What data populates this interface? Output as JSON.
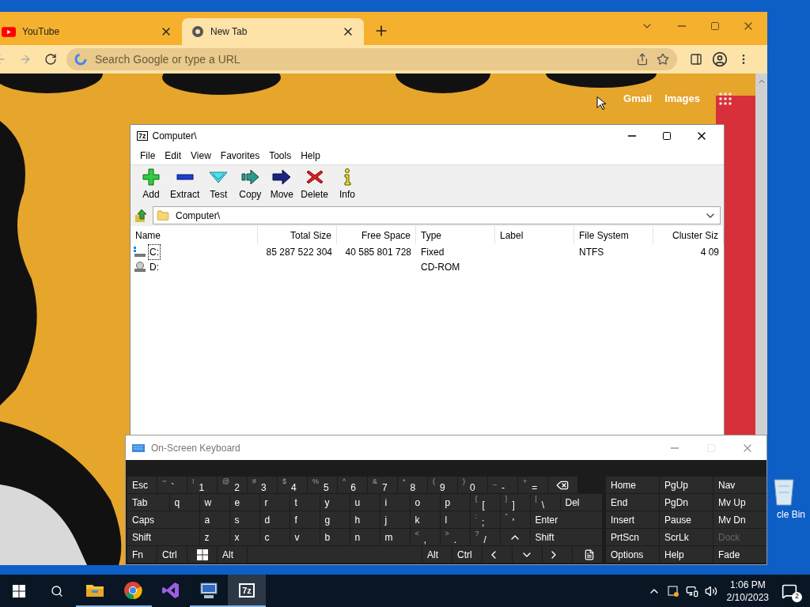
{
  "browser": {
    "tabs": [
      {
        "title": "YouTube",
        "selected": false
      },
      {
        "title": "New Tab",
        "selected": true
      }
    ],
    "omnibox": {
      "placeholder": "Search Google or type a URL"
    },
    "links": [
      "Gmail",
      "Images"
    ]
  },
  "archiver": {
    "logo": "7z",
    "title": "Computer\\",
    "menu": [
      "File",
      "Edit",
      "View",
      "Favorites",
      "Tools",
      "Help"
    ],
    "toolbar": [
      {
        "label": "Add",
        "kind": "add"
      },
      {
        "label": "Extract",
        "kind": "extract"
      },
      {
        "label": "Test",
        "kind": "test"
      },
      {
        "label": "Copy",
        "kind": "copy"
      },
      {
        "label": "Move",
        "kind": "move"
      },
      {
        "label": "Delete",
        "kind": "delete"
      },
      {
        "label": "Info",
        "kind": "info"
      }
    ],
    "path": "Computer\\",
    "columns": [
      "Name",
      "Total Size",
      "Free Space",
      "Type",
      "Label",
      "File System",
      "Cluster Siz"
    ],
    "rows": [
      {
        "kind": "disk",
        "selected": true,
        "cells": [
          "C:",
          "85 287 522 304",
          "40 585 801 728",
          "Fixed",
          "",
          "NTFS",
          "4 09"
        ]
      },
      {
        "kind": "cdrom",
        "selected": false,
        "cells": [
          "D:",
          "",
          "",
          "CD-ROM",
          "",
          "",
          ""
        ]
      }
    ]
  },
  "keyboard": {
    "title": "On-Screen Keyboard",
    "main_rows": [
      [
        {
          "kind": "char",
          "main": "Esc"
        },
        {
          "kind": "char",
          "shift": "~",
          "main": "`"
        },
        {
          "kind": "char",
          "shift": "!",
          "main": "1"
        },
        {
          "kind": "char",
          "shift": "@",
          "main": "2"
        },
        {
          "kind": "char",
          "shift": "#",
          "main": "3"
        },
        {
          "kind": "char",
          "shift": "$",
          "main": "4"
        },
        {
          "kind": "char",
          "shift": "%",
          "main": "5"
        },
        {
          "kind": "char",
          "shift": "^",
          "main": "6"
        },
        {
          "kind": "char",
          "shift": "&",
          "main": "7"
        },
        {
          "kind": "char",
          "shift": "*",
          "main": "8"
        },
        {
          "kind": "char",
          "shift": "(",
          "main": "9"
        },
        {
          "kind": "char",
          "shift": ")",
          "main": "0"
        },
        {
          "kind": "char",
          "shift": "_",
          "main": "-"
        },
        {
          "kind": "char",
          "shift": "+",
          "main": "="
        },
        {
          "kind": "backspace"
        }
      ],
      [
        {
          "kind": "wide",
          "main": "Tab"
        },
        {
          "kind": "char",
          "main": "q"
        },
        {
          "kind": "char",
          "main": "w"
        },
        {
          "kind": "char",
          "main": "e"
        },
        {
          "kind": "char",
          "main": "r"
        },
        {
          "kind": "char",
          "main": "t"
        },
        {
          "kind": "char",
          "main": "y"
        },
        {
          "kind": "char",
          "main": "u"
        },
        {
          "kind": "char",
          "main": "i"
        },
        {
          "kind": "char",
          "main": "o"
        },
        {
          "kind": "char",
          "main": "p"
        },
        {
          "kind": "char",
          "shift": "{",
          "main": "["
        },
        {
          "kind": "char",
          "shift": "}",
          "main": "]"
        },
        {
          "kind": "char",
          "shift": "|",
          "main": "\\"
        },
        {
          "kind": "wide",
          "main": "Del"
        }
      ],
      [
        {
          "kind": "wide",
          "main": "Caps"
        },
        {
          "kind": "char",
          "main": "a"
        },
        {
          "kind": "char",
          "main": "s"
        },
        {
          "kind": "char",
          "main": "d"
        },
        {
          "kind": "char",
          "main": "f"
        },
        {
          "kind": "char",
          "main": "g"
        },
        {
          "kind": "char",
          "main": "h"
        },
        {
          "kind": "char",
          "main": "j"
        },
        {
          "kind": "char",
          "main": "k"
        },
        {
          "kind": "char",
          "main": "l"
        },
        {
          "kind": "char",
          "shift": ":",
          "main": ";"
        },
        {
          "kind": "char",
          "shift": "\"",
          "main": "'"
        },
        {
          "kind": "wide",
          "main": "Enter"
        }
      ],
      [
        {
          "kind": "wide",
          "main": "Shift"
        },
        {
          "kind": "char",
          "main": "z"
        },
        {
          "kind": "char",
          "main": "x"
        },
        {
          "kind": "char",
          "main": "c"
        },
        {
          "kind": "char",
          "main": "v"
        },
        {
          "kind": "char",
          "main": "b"
        },
        {
          "kind": "char",
          "main": "n"
        },
        {
          "kind": "char",
          "main": "m"
        },
        {
          "kind": "char",
          "shift": "<",
          "main": ","
        },
        {
          "kind": "char",
          "shift": ">",
          "main": "."
        },
        {
          "kind": "char",
          "shift": "?",
          "main": "/"
        },
        {
          "kind": "up"
        },
        {
          "kind": "wide",
          "main": "Shift"
        }
      ],
      [
        {
          "kind": "char",
          "main": "Fn"
        },
        {
          "kind": "char",
          "main": "Ctrl"
        },
        {
          "kind": "windows"
        },
        {
          "kind": "char",
          "main": "Alt"
        },
        {
          "kind": "space"
        },
        {
          "kind": "char",
          "main": "Alt"
        },
        {
          "kind": "char",
          "main": "Ctrl"
        },
        {
          "kind": "left"
        },
        {
          "kind": "down"
        },
        {
          "kind": "right"
        },
        {
          "kind": "menu"
        }
      ]
    ],
    "side_rows": [
      [
        {
          "label": "Home",
          "disabled": false
        },
        {
          "label": "PgUp",
          "disabled": false
        },
        {
          "label": "Nav",
          "disabled": false
        }
      ],
      [
        {
          "label": "End",
          "disabled": false
        },
        {
          "label": "PgDn",
          "disabled": false
        },
        {
          "label": "Mv Up",
          "disabled": false
        }
      ],
      [
        {
          "label": "Insert",
          "disabled": false
        },
        {
          "label": "Pause",
          "disabled": false
        },
        {
          "label": "Mv Dn",
          "disabled": false
        }
      ],
      [
        {
          "label": "PrtScn",
          "disabled": false
        },
        {
          "label": "ScrLk",
          "disabled": false
        },
        {
          "label": "Dock",
          "disabled": true
        }
      ],
      [
        {
          "label": "Options",
          "disabled": false
        },
        {
          "label": "Help",
          "disabled": false
        },
        {
          "label": "Fade",
          "disabled": false
        }
      ]
    ]
  },
  "desktop_icons": [
    {
      "label": "cle Bin"
    }
  ],
  "taskbar": {
    "apps": [
      {
        "kind": "explorer",
        "selected": false,
        "running": true
      },
      {
        "kind": "chrome",
        "selected": false,
        "running": true
      },
      {
        "kind": "studio",
        "selected": false,
        "running": false
      },
      {
        "kind": "monitor",
        "selected": false,
        "running": true
      },
      {
        "kind": "sevenzip",
        "logo": "7z",
        "selected": true,
        "running": true
      }
    ],
    "time": "1:06 PM",
    "date": "2/10/2023",
    "notifications": "2"
  }
}
